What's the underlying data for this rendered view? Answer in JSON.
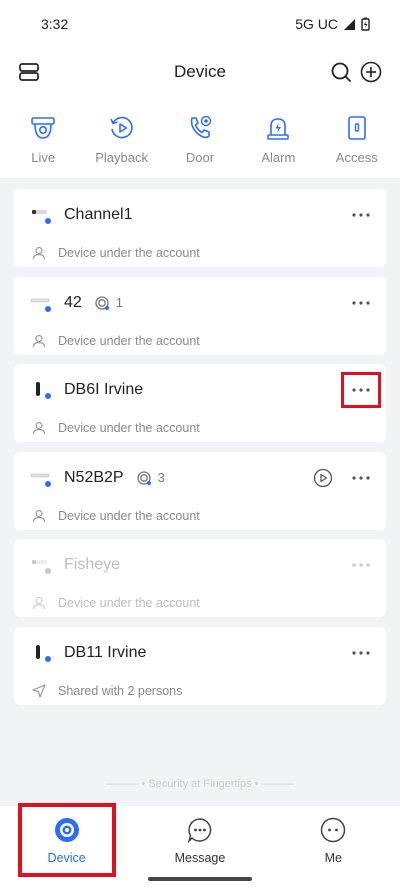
{
  "status_bar": {
    "time": "3:32",
    "network": "5G UC"
  },
  "header": {
    "title": "Device"
  },
  "quick_nav": [
    {
      "label": "Live",
      "icon": "camera-icon"
    },
    {
      "label": "Playback",
      "icon": "playback-icon"
    },
    {
      "label": "Door",
      "icon": "door-phone-icon"
    },
    {
      "label": "Alarm",
      "icon": "alarm-icon"
    },
    {
      "label": "Access",
      "icon": "access-icon"
    }
  ],
  "devices": [
    {
      "name": "Channel1",
      "subtitle": "Device under the account",
      "online": true
    },
    {
      "name": "42",
      "channels": "1",
      "subtitle": "Device under the account",
      "online": true
    },
    {
      "name": "DB6I Irvine",
      "subtitle": "Device under the account",
      "online": true,
      "more_highlighted": true
    },
    {
      "name": "N52B2P",
      "channels": "3",
      "subtitle": "Device under the account",
      "online": true,
      "has_play": true
    },
    {
      "name": "Fisheye",
      "subtitle": "Device under the account",
      "online": false
    },
    {
      "name": "DB11 Irvine",
      "subtitle": "Shared with 2 persons",
      "online": true
    }
  ],
  "footer": {
    "slogan": "Security at Fingertips"
  },
  "tabs": [
    {
      "label": "Device",
      "icon": "device-tab-icon",
      "active": true
    },
    {
      "label": "Message",
      "icon": "message-tab-icon",
      "active": false
    },
    {
      "label": "Me",
      "icon": "me-tab-icon",
      "active": false
    }
  ],
  "colors": {
    "accent": "#2e6ef5",
    "highlight": "#e01020",
    "background": "#f2f3f5"
  }
}
